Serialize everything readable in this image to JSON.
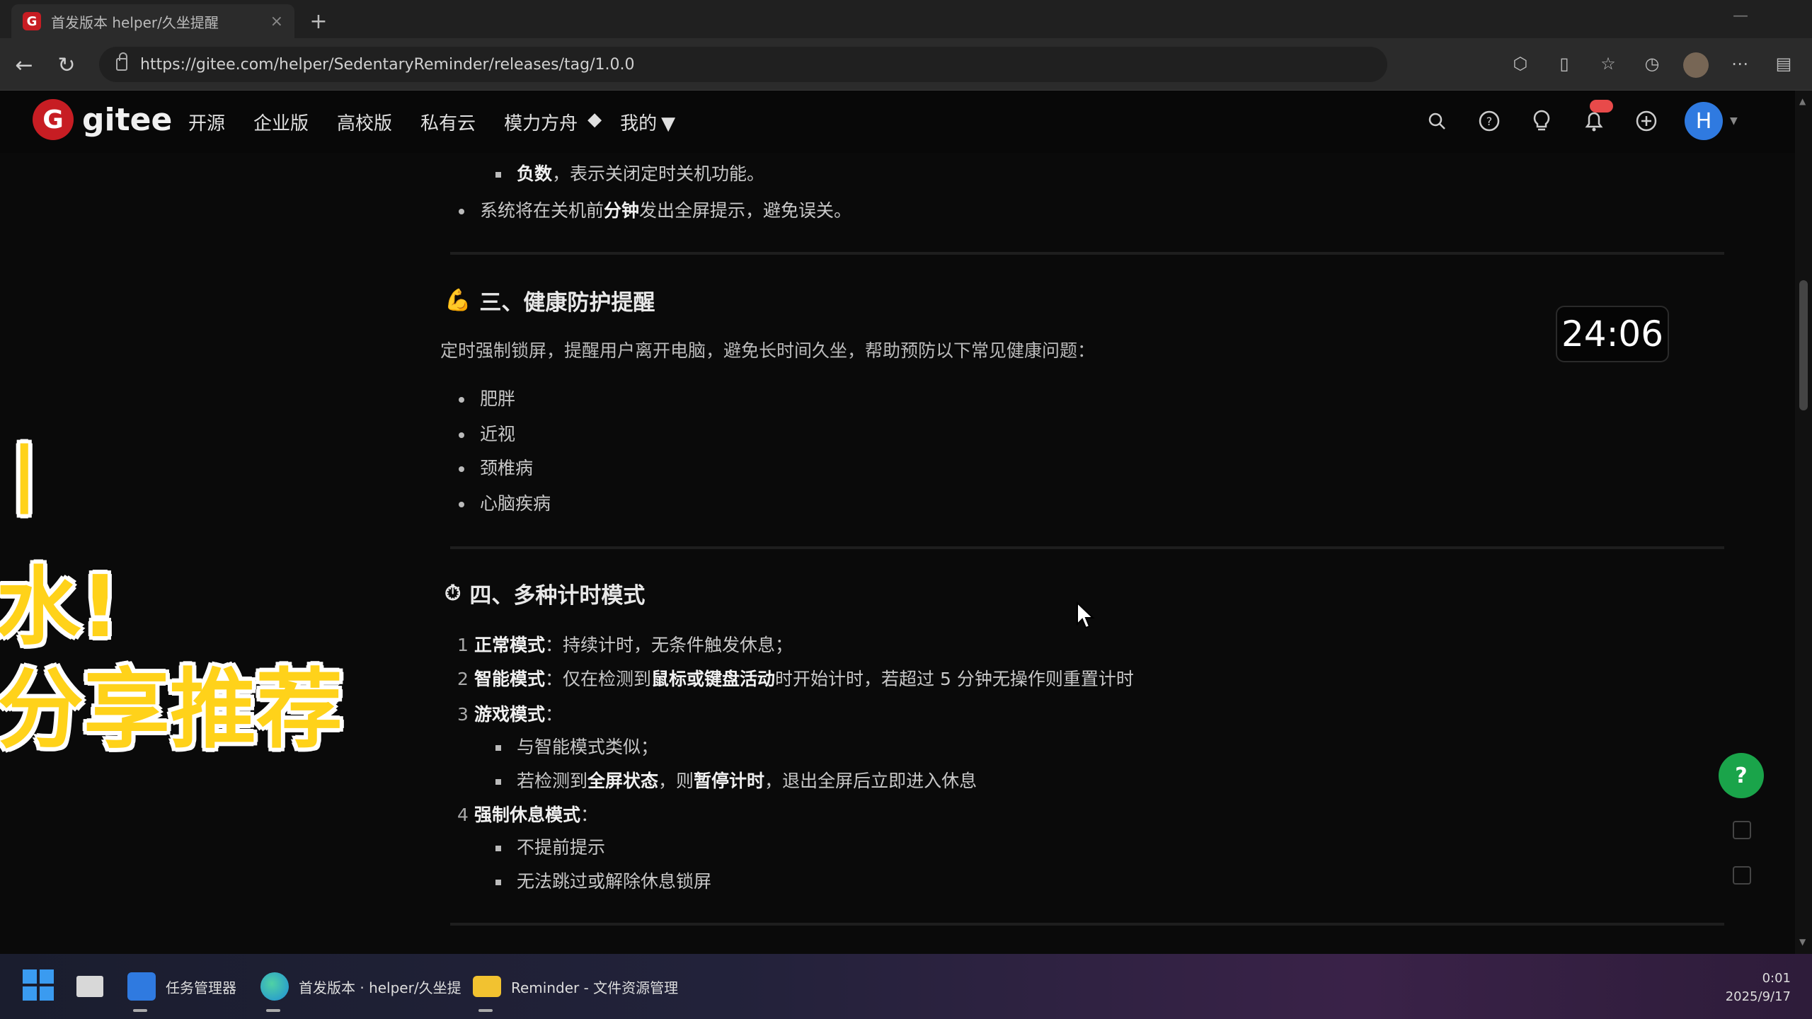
{
  "browser": {
    "tab_title": "首发版本 helper/久坐提醒",
    "tab_close": "×",
    "new_tab": "+",
    "url": "https://gitee.com/helper/SedentaryReminder/releases/tag/1.0.0"
  },
  "gitee": {
    "logo_text": "gitee",
    "logo_mark": "G",
    "nav": [
      "开源",
      "企业版",
      "高校版",
      "私有云",
      "模力方舟",
      "我的"
    ],
    "notif_badge": "",
    "avatar_letter": "H"
  },
  "content": {
    "top_items": {
      "item1_bold": "负数",
      "item1_text": "，表示关闭定时关机功能。",
      "item2_pre": "系统将在关机前",
      "item2_bold": "分钟",
      "item2_post": "发出全屏提示，避免误关。"
    },
    "section3": {
      "icon": "💪",
      "title": "三、健康防护提醒",
      "paragraph": "定时强制锁屏，提醒用户离开电脑，避免长时间久坐，帮助预防以下常见健康问题：",
      "items": [
        "肥胖",
        "近视",
        "颈椎病",
        "心脑疾病"
      ]
    },
    "section4": {
      "icon": "⏱",
      "title": "四、多种计时模式",
      "mode1_bold": "正常模式",
      "mode1_text": "：持续计时，无条件触发休息；",
      "mode2_bold": "智能模式",
      "mode2_pre": "：仅在检测到",
      "mode2_bold2": "鼠标或键盘活动",
      "mode2_post": "时开始计时，若超过 5 分钟无操作则重置计时",
      "mode3_bold": "游戏模式",
      "mode3_suffix": "：",
      "mode3_sub1": "与智能模式类似；",
      "mode3_sub2_pre": "若检测到",
      "mode3_sub2_bold": "全屏状态",
      "mode3_sub2_mid": "，则",
      "mode3_sub2_bold2": "暂停计时",
      "mode3_sub2_post": "，退出全屏后立即进入休息",
      "mode4_bold": "强制休息模式",
      "mode4_suffix": "：",
      "mode4_sub1": "不提前提示",
      "mode4_sub2": "无法跳过或解除休息锁屏",
      "numbers": [
        "1",
        "2",
        "3",
        "4"
      ]
    },
    "timer": "24:06",
    "help": "?"
  },
  "overlay": {
    "line1": "|",
    "line2": "水!",
    "line3": "分享推荐"
  },
  "taskbar": {
    "items": [
      {
        "label": "任务管理器",
        "color": "#2f7ae0"
      },
      {
        "label": "首发版本 · helper/久坐提",
        "color": "#1e8fd8"
      },
      {
        "label": "Reminder - 文件资源管理",
        "color": "#f2c230"
      }
    ],
    "time": "0:01",
    "date": "2025/9/17"
  }
}
